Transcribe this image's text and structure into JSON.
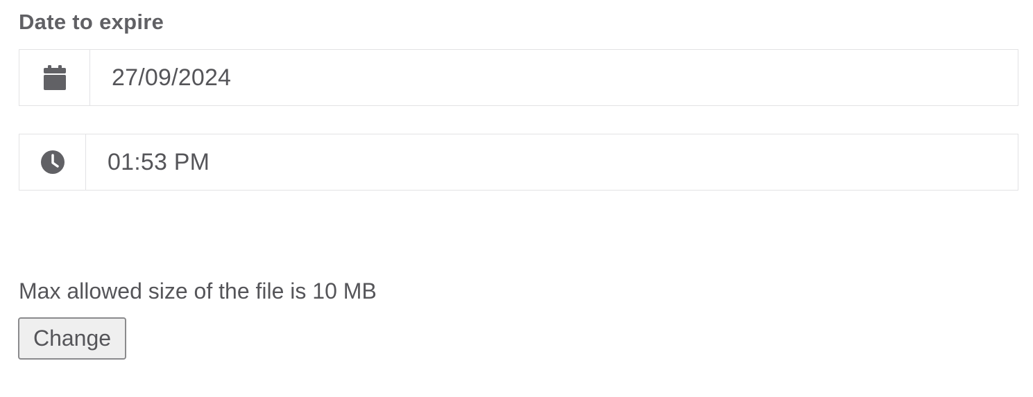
{
  "expiry": {
    "label": "Date to expire",
    "date": {
      "icon": "calendar-icon",
      "value": "27/09/2024"
    },
    "time": {
      "icon": "clock-icon",
      "value": "01:53 PM"
    }
  },
  "file": {
    "help_text": "Max allowed size of the file is 10 MB",
    "change_label": "Change"
  },
  "colors": {
    "text": "#555559",
    "icon": "#616165",
    "border": "#e2e2e4",
    "button_bg": "#efefef",
    "button_border": "#8a8a8c"
  }
}
